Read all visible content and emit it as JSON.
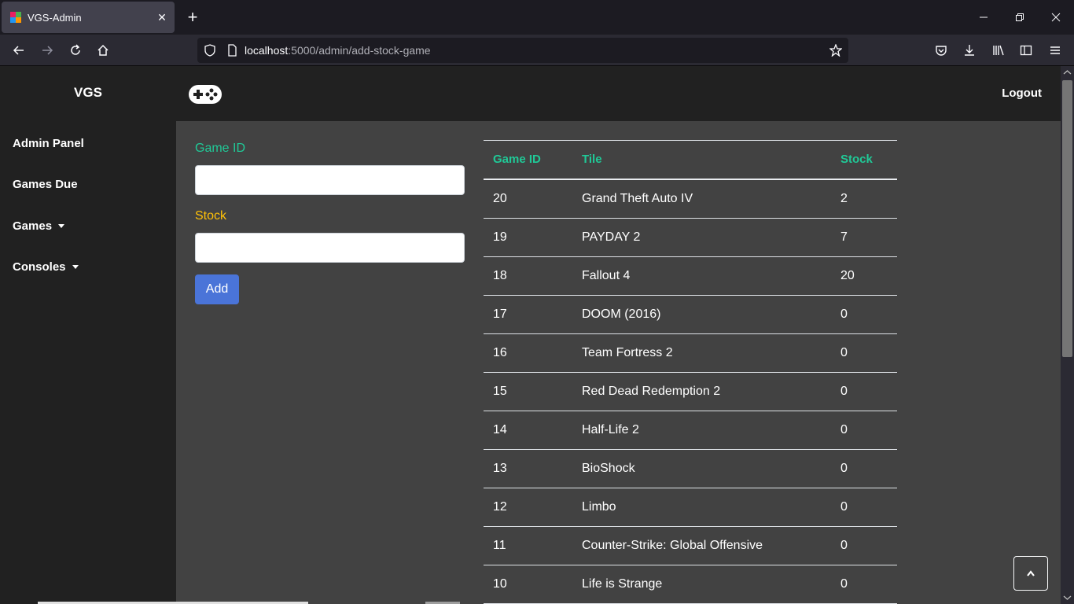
{
  "browser": {
    "tab_title": "VGS-Admin",
    "tab_close_glyph": "✕",
    "new_tab_glyph": "+",
    "url_host": "localhost",
    "url_rest": ":5000/admin/add-stock-game"
  },
  "sidebar": {
    "brand": "VGS",
    "items": [
      {
        "label": "Admin Panel"
      },
      {
        "label": "Games Due"
      },
      {
        "label": "Games"
      },
      {
        "label": "Consoles"
      }
    ]
  },
  "header": {
    "logout_label": "Logout"
  },
  "form": {
    "game_id_label": "Game ID",
    "game_id_color": "#20c997",
    "game_id_value": "",
    "stock_label": "Stock",
    "stock_color": "#ffc107",
    "stock_value": "",
    "add_label": "Add"
  },
  "table": {
    "headers": [
      "Game ID",
      "Tile",
      "Stock"
    ],
    "header_color": "#20c997",
    "rows": [
      {
        "id": "20",
        "title": "Grand Theft Auto IV",
        "stock": "2"
      },
      {
        "id": "19",
        "title": "PAYDAY 2",
        "stock": "7"
      },
      {
        "id": "18",
        "title": "Fallout 4",
        "stock": "20"
      },
      {
        "id": "17",
        "title": "DOOM (2016)",
        "stock": "0"
      },
      {
        "id": "16",
        "title": "Team Fortress 2",
        "stock": "0"
      },
      {
        "id": "15",
        "title": "Red Dead Redemption 2",
        "stock": "0"
      },
      {
        "id": "14",
        "title": "Half-Life 2",
        "stock": "0"
      },
      {
        "id": "13",
        "title": "BioShock",
        "stock": "0"
      },
      {
        "id": "12",
        "title": "Limbo",
        "stock": "0"
      },
      {
        "id": "11",
        "title": "Counter-Strike: Global Offensive",
        "stock": "0"
      },
      {
        "id": "10",
        "title": "Life is Strange",
        "stock": "0"
      }
    ]
  },
  "accent": {
    "button": "#4a74d8",
    "sidebar_bg": "#212121",
    "content_bg": "#424242"
  }
}
